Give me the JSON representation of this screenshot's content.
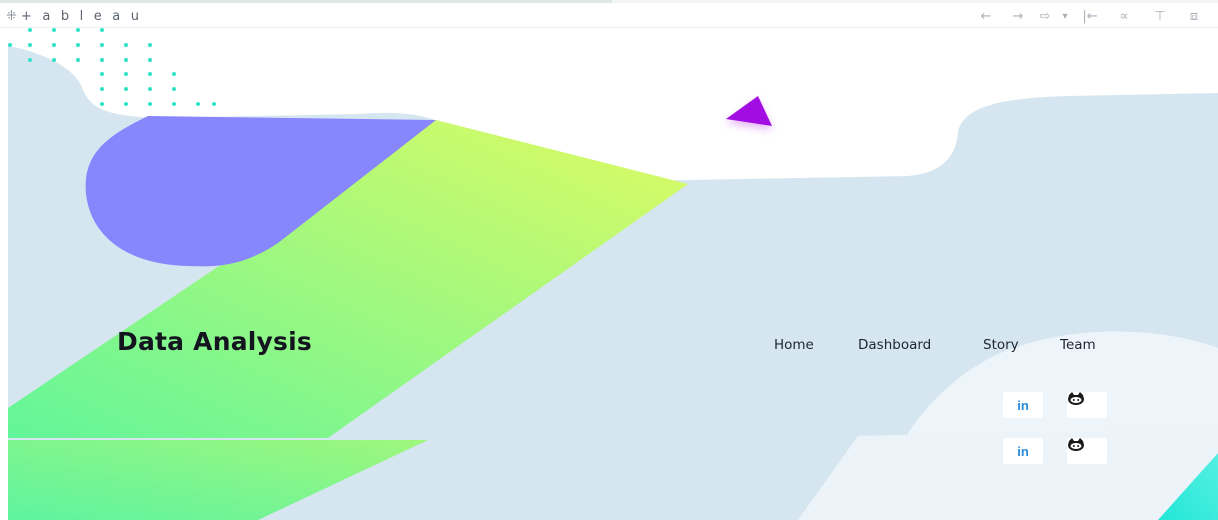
{
  "toolbar": {
    "logo_mark": "⁜",
    "logo_text": "+ a b l e a u",
    "icons": [
      "undo-icon",
      "redo-icon",
      "revert-icon",
      "dropdown-icon",
      "reset-icon",
      "share-icon",
      "download-icon",
      "fullscreen-icon"
    ],
    "glyphs": {
      "undo": "←",
      "redo": "→",
      "revert": "⇨",
      "dropdown": "▾",
      "reset": "|←",
      "share": "∝",
      "download": "⊤",
      "fullscreen": "⧈"
    }
  },
  "dashboard": {
    "title": "Data Analysis",
    "nav": {
      "home": "Home",
      "dashboard": "Dashboard",
      "story": "Story",
      "team": "Team"
    },
    "social": {
      "linkedin_label": "in",
      "github_icon": "github-icon"
    }
  },
  "colors": {
    "background_blue": "#d6e6f0",
    "light_blob": "#eef5fa",
    "purple_blob": "#8886fd",
    "gradient_start": "#62f59a",
    "gradient_end": "#dffb63",
    "triangle": "#a10de3",
    "dots": "#2fe3c4",
    "linkedin": "#2a8adb"
  }
}
